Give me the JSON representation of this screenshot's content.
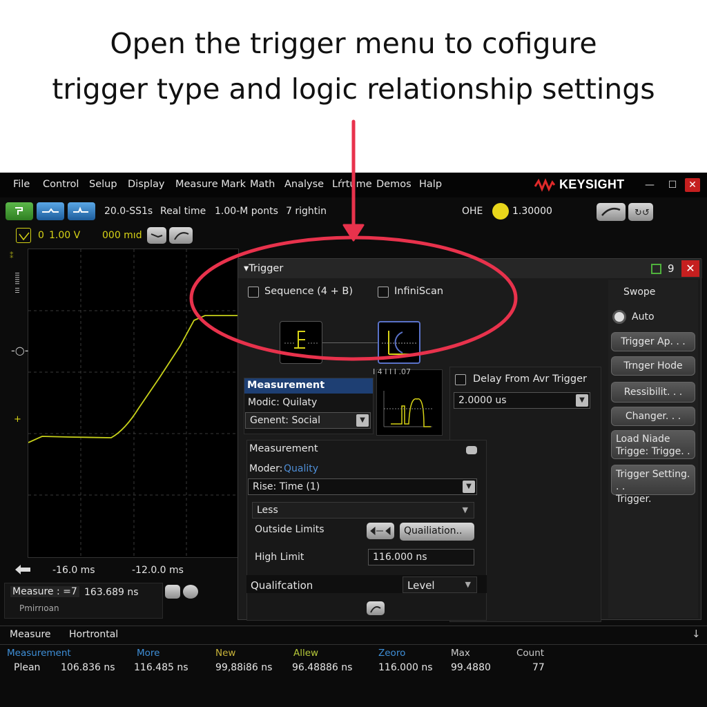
{
  "instruction": {
    "line1": "Open the trigger menu to cofigure",
    "line2": "trigger type and logic relationship settings"
  },
  "menu": [
    "File",
    "Control",
    "Selup",
    "Display",
    "Measure Mark",
    "Math",
    "Analyse",
    "Lŕrtume",
    "Demos",
    "Halp"
  ],
  "brand": "KEYSIGHT",
  "toolbar": {
    "sample_rate": "20.0-SS1s",
    "mode": "Real time",
    "points": "1.00-M ponts",
    "right": "7 rightin",
    "ohe": "OHE",
    "trigger_level": "1.30000"
  },
  "channel": {
    "num": "0",
    "scale": "1.00 V",
    "offset": "000 mıd"
  },
  "scope": {
    "x_labels": [
      "-16.0 ms",
      "-12.0.0 ms"
    ],
    "measure_label": "Measure : =7",
    "measure_value": "163.689 ns",
    "measure_sub": "Pmirrıoan"
  },
  "dialog": {
    "title": "Trigger",
    "pin": "9",
    "sequence_label": "Sequence (4  + B)",
    "infiniscan_label": "InfiniScan",
    "measurement_header": "Measurement",
    "modic": "Modic: Quilaty",
    "genent": "Genent: Social",
    "thumb_caption": "I 4 I I I .07",
    "delay_label": "Delay From Avr Trigger",
    "delay_value": "2.0000 us",
    "inner": {
      "title": "Measurement",
      "moder_label": "Moder:",
      "moder_value": "Quality",
      "rise": "Rise: Time (1)",
      "less": "Less",
      "outside": "Outside Limits",
      "qualification_btn": "Quailiation..",
      "high_limit_label": "High Limit",
      "high_limit_value": "116.000 ns",
      "qualification_label": "Qualifcation",
      "qualification_value": "Level"
    },
    "side": {
      "swope": "Swope",
      "auto": "Auto",
      "buttons": [
        "Trigger Ap. . .",
        "Trnger Hode",
        "Ressibilit. . .",
        "Changer. . .",
        "Load Niade\nTrigge:  Trigge. .",
        "Trigger Setting. . .\nTrigger."
      ]
    }
  },
  "results": {
    "tabs": [
      "Measure",
      "Hortrontal"
    ],
    "headers": [
      {
        "label": "Measurement",
        "color": "#3e8fd8"
      },
      {
        "label": "More",
        "color": "#3e8fd8"
      },
      {
        "label": "New",
        "color": "#c9b43a"
      },
      {
        "label": "Allew",
        "color": "#b6c93a"
      },
      {
        "label": "Zeoro",
        "color": "#3e8fd8"
      },
      {
        "label": "Max",
        "color": "#cccccc"
      },
      {
        "label": "Count",
        "color": "#cccccc"
      }
    ],
    "row": [
      "Plean",
      "106.836 ns",
      "116.485 ns",
      "99,88i86 ns",
      "96.48886 ns",
      "116.000 ns",
      "99.4880",
      "77"
    ]
  },
  "colors": {
    "annotation": "#e8324c",
    "trace": "#c8d21a",
    "dialog_header": "#1e3f73"
  }
}
